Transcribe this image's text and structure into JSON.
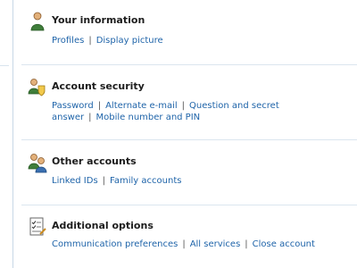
{
  "sections": {
    "your_information": {
      "title": "Your information",
      "icon": "user-icon",
      "links": [
        "Profiles",
        "Display picture"
      ]
    },
    "account_security": {
      "title": "Account security",
      "icon": "user-shield-icon",
      "links": [
        "Password",
        "Alternate e-mail",
        "Question and secret answer",
        "Mobile number and PIN"
      ]
    },
    "other_accounts": {
      "title": "Other accounts",
      "icon": "users-icon",
      "links": [
        "Linked IDs",
        "Family accounts"
      ]
    },
    "additional_options": {
      "title": "Additional options",
      "icon": "checklist-icon",
      "links": [
        "Communication preferences",
        "All services",
        "Close account"
      ]
    }
  },
  "separator": "|",
  "colors": {
    "link": "#1f64a9",
    "title": "#1d1d1d",
    "divider": "#dbe6ef",
    "left_rule": "#c7d7e6"
  }
}
